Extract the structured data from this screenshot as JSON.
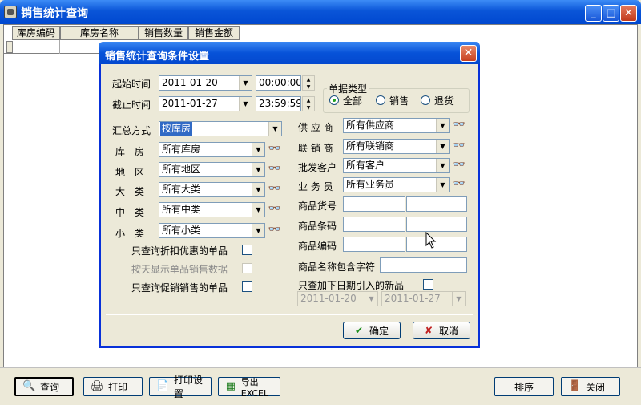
{
  "main": {
    "title": "销售统计查询",
    "columns": [
      "库房编码",
      "库房名称",
      "销售数量",
      "销售金额"
    ]
  },
  "toolbar": {
    "query": "查询",
    "print": "打印",
    "print_settings": "打印设置",
    "export": "导出EXCEL",
    "sort": "排序",
    "close": "关闭"
  },
  "dialog": {
    "title": "销售统计查询条件设置",
    "start_label": "起始时间",
    "start_date": "2011-01-20",
    "start_time": "00:00:00",
    "end_label": "截止时间",
    "end_date": "2011-01-27",
    "end_time": "23:59:59",
    "doc_type": {
      "label": "单据类型",
      "options": [
        "全部",
        "销售",
        "退货"
      ],
      "selected": "全部"
    },
    "summary": {
      "label": "汇总方式",
      "value": "按库房"
    },
    "left_filters": [
      {
        "label": "库　房",
        "value": "所有库房"
      },
      {
        "label": "地　区",
        "value": "所有地区"
      },
      {
        "label": "大　类",
        "value": "所有大类"
      },
      {
        "label": "中　类",
        "value": "所有中类"
      },
      {
        "label": "小　类",
        "value": "所有小类"
      }
    ],
    "right_filters": [
      {
        "label": "供 应 商",
        "value": "所有供应商"
      },
      {
        "label": "联 销 商",
        "value": "所有联销商"
      },
      {
        "label": "批发客户",
        "value": "所有客户"
      },
      {
        "label": "业 务 员",
        "value": "所有业务员"
      }
    ],
    "product_fields": [
      "商品货号",
      "商品条码",
      "商品编码"
    ],
    "name_contains": "商品名称包含字符",
    "checks": {
      "discount_only": "只查询折扣优惠的单品",
      "daily_detail": "按天显示单品销售数据",
      "promo_only": "只查询促销销售的单品",
      "new_items": "只查加下日期引入的新品"
    },
    "new_from": "2011-01-20",
    "new_to": "2011-01-27",
    "ok": "确定",
    "cancel": "取消"
  }
}
